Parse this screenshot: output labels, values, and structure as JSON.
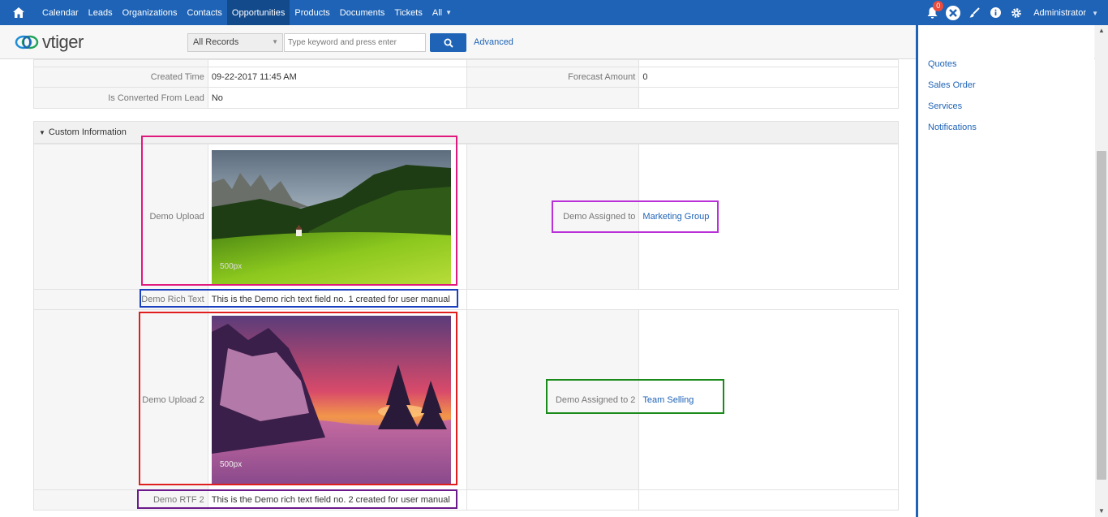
{
  "topnav": {
    "items": [
      "Calendar",
      "Leads",
      "Organizations",
      "Contacts",
      "Opportunities",
      "Products",
      "Documents",
      "Tickets",
      "All"
    ],
    "active": "Opportunities",
    "notification_count": "0",
    "user": "Administrator"
  },
  "toolbar": {
    "logo_text": "vtiger",
    "records_select": "All Records",
    "search_placeholder": "Type keyword and press enter",
    "advanced_label": "Advanced"
  },
  "details": {
    "created_time_label": "Created Time",
    "created_time_value": "09-22-2017 11:45 AM",
    "forecast_amount_label": "Forecast Amount",
    "forecast_amount_value": "0",
    "converted_label": "Is Converted From Lead",
    "converted_value": "No"
  },
  "custom_info": {
    "section_title": "Custom Information",
    "demo_upload_label": "Demo Upload",
    "demo_assigned_label": "Demo Assigned to",
    "demo_assigned_value": "Marketing Group",
    "demo_rich_text_label": "Demo Rich Text",
    "demo_rich_text_value": "This is the Demo rich text field no. 1 created for user manual",
    "demo_upload2_label": "Demo Upload 2",
    "demo_assigned2_label": "Demo Assigned to 2",
    "demo_assigned2_value": "Team Selling",
    "demo_rtf2_label": "Demo RTF 2",
    "demo_rtf2_value": "This is the Demo rich text field no. 2 created for user manual",
    "watermark": "500px"
  },
  "sidebar": {
    "items": [
      "Quotes",
      "Sales Order",
      "Services",
      "Notifications"
    ]
  },
  "colors": {
    "nav_blue": "#1e63b6",
    "highlight_upload": "#e0197d",
    "highlight_rich_text": "#1a3fbf",
    "highlight_assigned": "#b92fd8",
    "highlight_upload2": "#e01e1e",
    "highlight_assigned2": "#1a8a1a",
    "highlight_rtf2": "#6a1a8a"
  }
}
